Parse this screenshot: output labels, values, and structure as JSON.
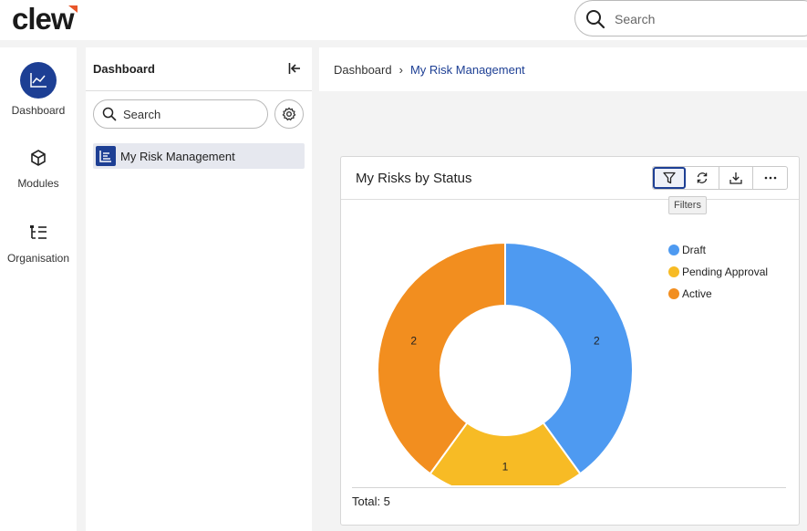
{
  "app": {
    "logo_text": "clew"
  },
  "topbar": {
    "search_placeholder": "Search"
  },
  "leftnav": {
    "items": [
      {
        "label": "Dashboard",
        "icon": "chart-line-icon",
        "active": true
      },
      {
        "label": "Modules",
        "icon": "cube-icon",
        "active": false
      },
      {
        "label": "Organisation",
        "icon": "org-tree-icon",
        "active": false
      }
    ]
  },
  "sidebar": {
    "title": "Dashboard",
    "search_placeholder": "Search",
    "items": [
      {
        "label": "My Risk Management",
        "icon": "list-chart-icon"
      }
    ]
  },
  "breadcrumb": {
    "root": "Dashboard",
    "separator": "›",
    "current": "My Risk Management"
  },
  "card": {
    "title": "My Risks by Status",
    "toolbar": [
      {
        "name": "filter-icon",
        "tooltip": "Filters"
      },
      {
        "name": "refresh-icon"
      },
      {
        "name": "download-icon"
      },
      {
        "name": "more-icon"
      }
    ],
    "tooltip_text": "Filters",
    "total_label": "Total: 5"
  },
  "colors": {
    "accent": "#1d3f94",
    "logo_accent": "#e8562a"
  },
  "chart_data": {
    "type": "pie",
    "style": "donut",
    "categories": [
      "Draft",
      "Pending Approval",
      "Active"
    ],
    "values": [
      2,
      1,
      2
    ],
    "colors": [
      "#4e9af1",
      "#f7bb25",
      "#f28e1f"
    ],
    "legend": "right"
  }
}
